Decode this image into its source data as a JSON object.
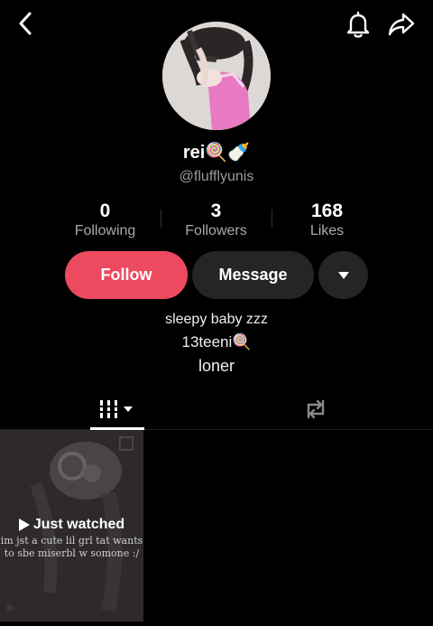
{
  "profile": {
    "name": "rei",
    "name_emoji": "🍭🍼",
    "handle": "@flufflyunis"
  },
  "stats": [
    {
      "value": "0",
      "label": "Following"
    },
    {
      "value": "3",
      "label": "Followers"
    },
    {
      "value": "168",
      "label": "Likes"
    }
  ],
  "actions": {
    "follow": "Follow",
    "message": "Message"
  },
  "bio": {
    "line1": "sleepy baby zzz",
    "line2": "13teeni🍭",
    "line3": "loner"
  },
  "video": {
    "badge": "Just watched",
    "caption": "im jst a cute lil grl tat wants to sbe miserbl w somone :/"
  },
  "colors": {
    "follow": "#ee4a5f",
    "background": "#000000",
    "secondary_button": "#252525"
  },
  "icons": [
    "chevron-left-icon",
    "bell-icon",
    "share-icon",
    "caret-down-icon",
    "grid-icon",
    "repost-icon",
    "play-icon"
  ]
}
